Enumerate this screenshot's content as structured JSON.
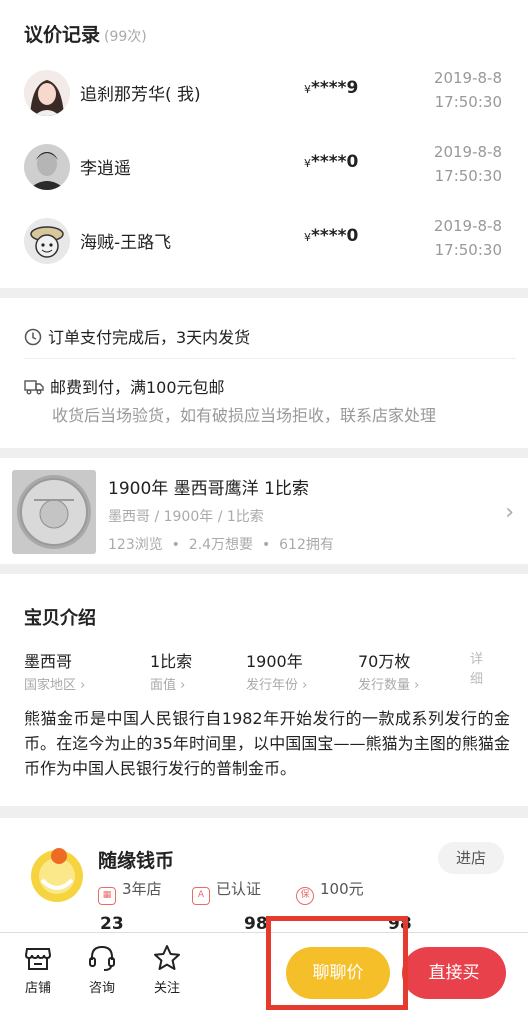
{
  "bids": {
    "title": "议价记录",
    "count": "(99次)",
    "rows": [
      {
        "name": "追刹那芳华( 我)",
        "currency": "¥",
        "price": "****9",
        "date": "2019-8-8",
        "time": "17:50:30"
      },
      {
        "name": "李逍遥",
        "currency": "¥",
        "price": "****0",
        "date": "2019-8-8",
        "time": "17:50:30"
      },
      {
        "name": "海贼-王路飞",
        "currency": "¥",
        "price": "****0",
        "date": "2019-8-8",
        "time": "17:50:30"
      }
    ]
  },
  "shipping": {
    "delivery": "订单支付完成后，3天内发货",
    "postage": "邮费到付，满100元包邮",
    "note": "收货后当场验货，如有破损应当场拒收，联系店家处理"
  },
  "product": {
    "title": "1900年 墨西哥鹰洋 1比索",
    "subtitle": "墨西哥 / 1900年 / 1比索",
    "views": "123浏览",
    "wants": "2.4万想要",
    "owns": "612拥有"
  },
  "intro": {
    "title": "宝贝介绍",
    "attrs": [
      {
        "value": "墨西哥",
        "key": "国家地区"
      },
      {
        "value": "1比索",
        "key": "面值"
      },
      {
        "value": "1900年",
        "key": "发行年份"
      },
      {
        "value": "70万枚",
        "key": "发行数量"
      }
    ],
    "more": "详细",
    "description": "熊猫金币是中国人民银行自1982年开始发行的一款成系列发行的金币。在迄今为止的35年时间里，以中国国宝——熊猫为主图的熊猫金币作为中国人民银行发行的普制金币。"
  },
  "shop": {
    "name": "随缘钱币",
    "enter": "进店",
    "years": "3年店",
    "certified": "已认证",
    "deposit": "100元",
    "stats": [
      "23",
      "98",
      "98"
    ]
  },
  "bar": {
    "store": "店铺",
    "consult": "咨询",
    "follow": "关注",
    "chat": "聊聊价",
    "buy": "直接买"
  },
  "colors": {
    "accent_yellow": "#f5bf2a",
    "accent_red": "#e8414b",
    "highlight": "#e53b2f"
  }
}
